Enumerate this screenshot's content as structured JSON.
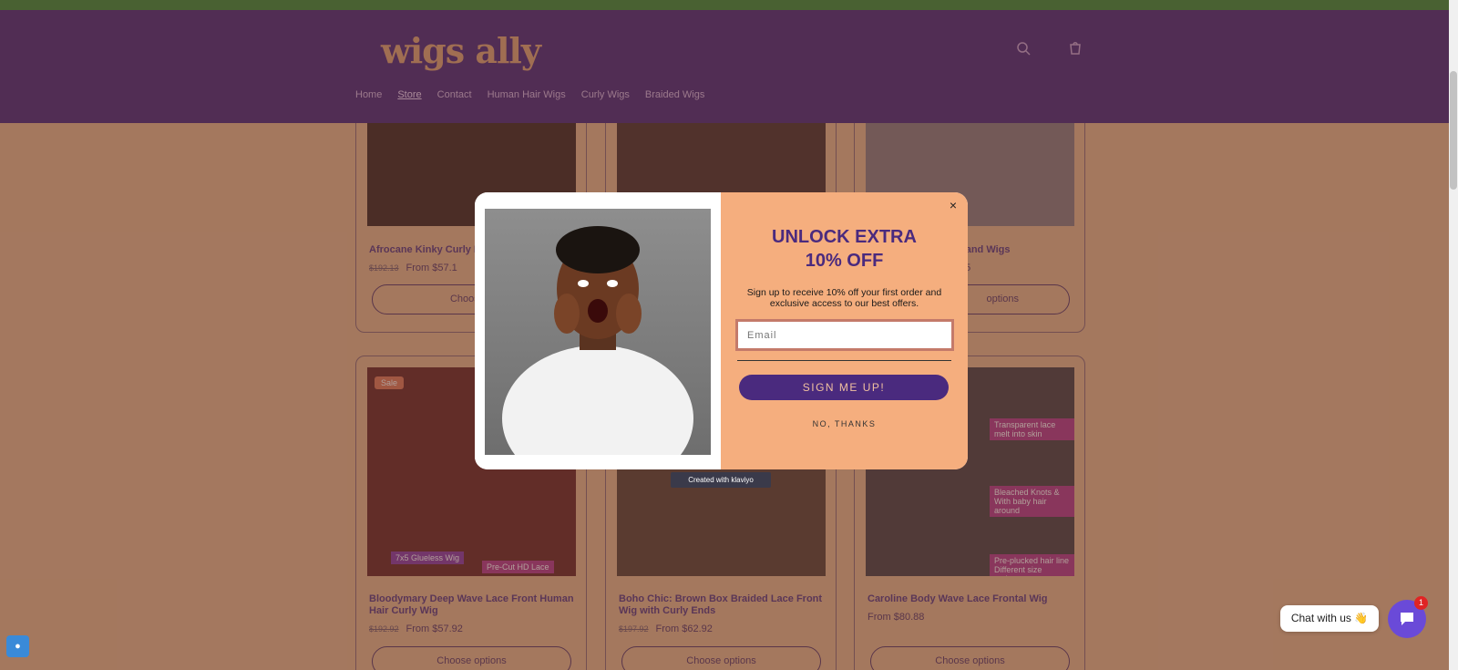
{
  "header": {
    "logo": "wigs ally",
    "search_icon": "search-icon",
    "cart_icon": "cart-icon",
    "nav": [
      {
        "label": "Home"
      },
      {
        "label": "Store"
      },
      {
        "label": "Contact"
      },
      {
        "label": "Human Hair Wigs"
      },
      {
        "label": "Curly Wigs"
      },
      {
        "label": "Braided Wigs"
      }
    ]
  },
  "products": {
    "row1": [
      {
        "title": "Afrocane Kinky Curly I",
        "old_price": "$192.13",
        "price": "From $57.1",
        "button": "Choose o"
      },
      {
        "title": "",
        "old_price": "",
        "price": "",
        "button": ""
      },
      {
        "title": "band Wigs",
        "old_price": "",
        "price": "85",
        "button": "options"
      }
    ],
    "row2": [
      {
        "sale": "Sale",
        "title": "Bloodymary Deep Wave Lace Front Human Hair Curly Wig",
        "old_price": "$192.92",
        "price": "From $57.92",
        "button": "Choose options",
        "labels": [
          "7x5 Glueless Wig",
          "Pre-Cut HD Lace"
        ]
      },
      {
        "title": "Boho Chic: Brown Box Braided Lace Front Wig with Curly Ends",
        "old_price": "$197.92",
        "price": "From $62.92",
        "button": "Choose options"
      },
      {
        "title": "Caroline Body Wave Lace Frontal Wig",
        "old_price": "",
        "price": "From $80.88",
        "button": "Choose options",
        "labels": [
          "Transparent lace melt into skin",
          "Bleached Knots & With baby hair around",
          "Pre-plucked hair line Different size options"
        ]
      }
    ]
  },
  "popup": {
    "headline_line1": "UNLOCK EXTRA",
    "headline_line2": "10% OFF",
    "subtext": "Sign up to receive 10% off your first order and exclusive access to our best offers.",
    "email_placeholder": "Email",
    "signup_button": "SIGN ME UP!",
    "decline": "NO, THANKS",
    "close": "×",
    "created_with": "Created with klaviyo"
  },
  "chat": {
    "bubble": "Chat with us 👋",
    "badge": "1"
  },
  "colors": {
    "header_bg": "#4a2a7e",
    "announce_bar": "#3a8c3c",
    "popup_right_bg": "#f5ae7e",
    "signup_bg": "#4a2a7e",
    "chat_button": "#6a4ad8"
  }
}
